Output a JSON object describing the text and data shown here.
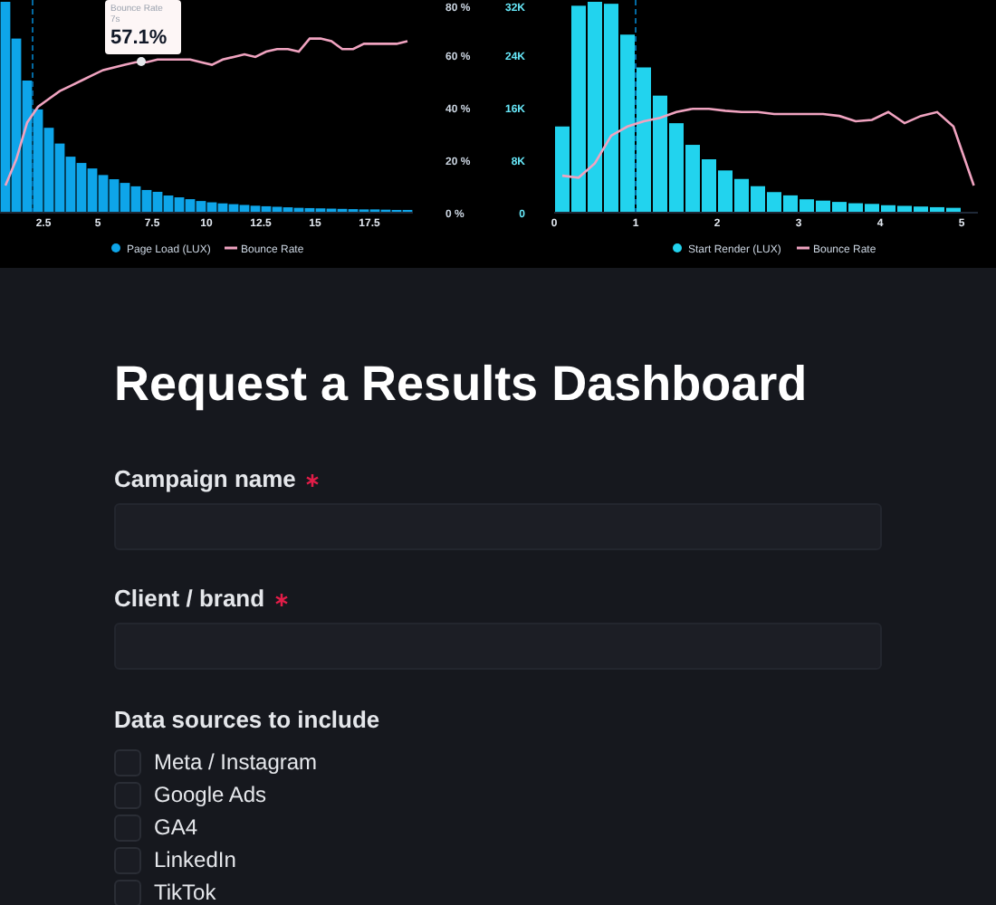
{
  "charts": [
    {
      "chart_data": {
        "type": "bar",
        "x": [
          0.75,
          1.25,
          1.75,
          2.25,
          2.75,
          3.25,
          3.75,
          4.25,
          4.75,
          5.25,
          5.75,
          6.25,
          6.75,
          7.25,
          7.75,
          8.25,
          8.75,
          9.25,
          9.75,
          10.25,
          10.75,
          11.25,
          11.75,
          12.25,
          12.75,
          13.25,
          13.75,
          14.25,
          14.75,
          15.25,
          15.75,
          16.25,
          16.75,
          17.25,
          17.75,
          18.25,
          18.75,
          19.25
        ],
        "series": [
          {
            "name": "Page Load (LUX)",
            "color": "#0ea5e9",
            "values": [
              80,
              66,
              50,
              39,
              32,
              26,
              21,
              18.6,
              16.5,
              14,
              12.4,
              11,
              9.7,
              8.3,
              7.6,
              6.2,
              5.5,
              4.8,
              4.1,
              3.6,
              3.2,
              2.9,
              2.6,
              2.3,
              2.1,
              1.9,
              1.7,
              1.5,
              1.4,
              1.3,
              1.2,
              1.1,
              1,
              0.9,
              0.9,
              0.8,
              0.7,
              0.7
            ]
          },
          {
            "name": "Bounce Rate",
            "type": "line",
            "color": "#f0a3c0",
            "values": [
              10,
              20,
              34,
              40,
              43,
              46,
              48,
              50,
              52,
              54,
              55,
              56,
              57,
              57,
              58,
              58,
              58,
              58,
              57,
              56,
              58,
              59,
              60,
              59,
              61,
              62,
              62,
              61,
              66,
              66,
              65,
              62,
              62,
              64,
              64,
              64,
              64,
              65
            ]
          }
        ],
        "legend": "bottom",
        "xlim": [
          0.5,
          19.5
        ],
        "ylim": [
          0,
          80
        ],
        "yticks": [
          {
            "value": 0,
            "label": "0 %"
          },
          {
            "value": 20,
            "label": "20 %"
          },
          {
            "value": 40,
            "label": "40 %"
          },
          {
            "value": 60,
            "label": "60 %"
          },
          {
            "value": 80,
            "label": "80 %"
          }
        ],
        "xticks": [
          2.5,
          5,
          7.5,
          10,
          12.5,
          15,
          17.5
        ],
        "ref_lines": [
          {
            "axis": "x",
            "value": 2
          }
        ]
      },
      "tooltip": {
        "title": "Bounce Rate",
        "subtitle": "7s",
        "value": "57.1%"
      }
    },
    {
      "chart_data": {
        "type": "bar",
        "x": [
          0.1,
          0.3,
          0.5,
          0.7,
          0.9,
          1.1,
          1.3,
          1.5,
          1.7,
          1.9,
          2.1,
          2.3,
          2.5,
          2.7,
          2.9,
          3.1,
          3.3,
          3.5,
          3.7,
          3.9,
          4.1,
          4.3,
          4.5,
          4.7,
          4.9,
          5.15
        ],
        "series": [
          {
            "name": "Start Render (LUX)",
            "color": "#22d3ee",
            "values": [
              13,
              31.4,
              32,
              31.7,
              27,
              22,
              17.7,
              13.5,
              10.2,
              8,
              6.3,
              5,
              3.9,
              3,
              2.5,
              1.9,
              1.7,
              1.5,
              1.3,
              1.2,
              1,
              0.9,
              0.8,
              0.7,
              0.6,
              null
            ]
          },
          {
            "name": "Bounce Rate",
            "type": "line",
            "color": "#f0a3c0",
            "values": [
              5.5,
              5.2,
              7.4,
              11.6,
              13,
              13.8,
              14.3,
              15.2,
              15.7,
              15.7,
              15.4,
              15.2,
              15.2,
              14.9,
              14.9,
              14.9,
              14.9,
              14.6,
              13.8,
              14,
              15.2,
              13.5,
              14.6,
              15.2,
              13,
              4
            ]
          }
        ],
        "legend": "bottom",
        "xlim": [
          0,
          5.2
        ],
        "ylim": [
          0,
          32
        ],
        "yticks": [
          {
            "value": 0,
            "label": "0"
          },
          {
            "value": 8,
            "label": "8K"
          },
          {
            "value": 16,
            "label": "16K"
          },
          {
            "value": 24,
            "label": "24K"
          },
          {
            "value": 32,
            "label": "32K"
          }
        ],
        "xticks": [
          0,
          1,
          2,
          3,
          4,
          5
        ],
        "ref_lines": [
          {
            "axis": "x",
            "value": 1
          }
        ]
      }
    }
  ],
  "form": {
    "title": "Request a Results Dashboard",
    "fields": [
      {
        "label": "Campaign name",
        "required": true
      },
      {
        "label": "Client / brand",
        "required": true
      }
    ],
    "sources": {
      "label": "Data sources to include",
      "options": [
        {
          "label": "Meta / Instagram",
          "checked": false
        },
        {
          "label": "Google Ads",
          "checked": false
        },
        {
          "label": "GA4",
          "checked": false
        },
        {
          "label": "LinkedIn",
          "checked": false
        },
        {
          "label": "TikTok",
          "checked": false
        }
      ]
    }
  }
}
